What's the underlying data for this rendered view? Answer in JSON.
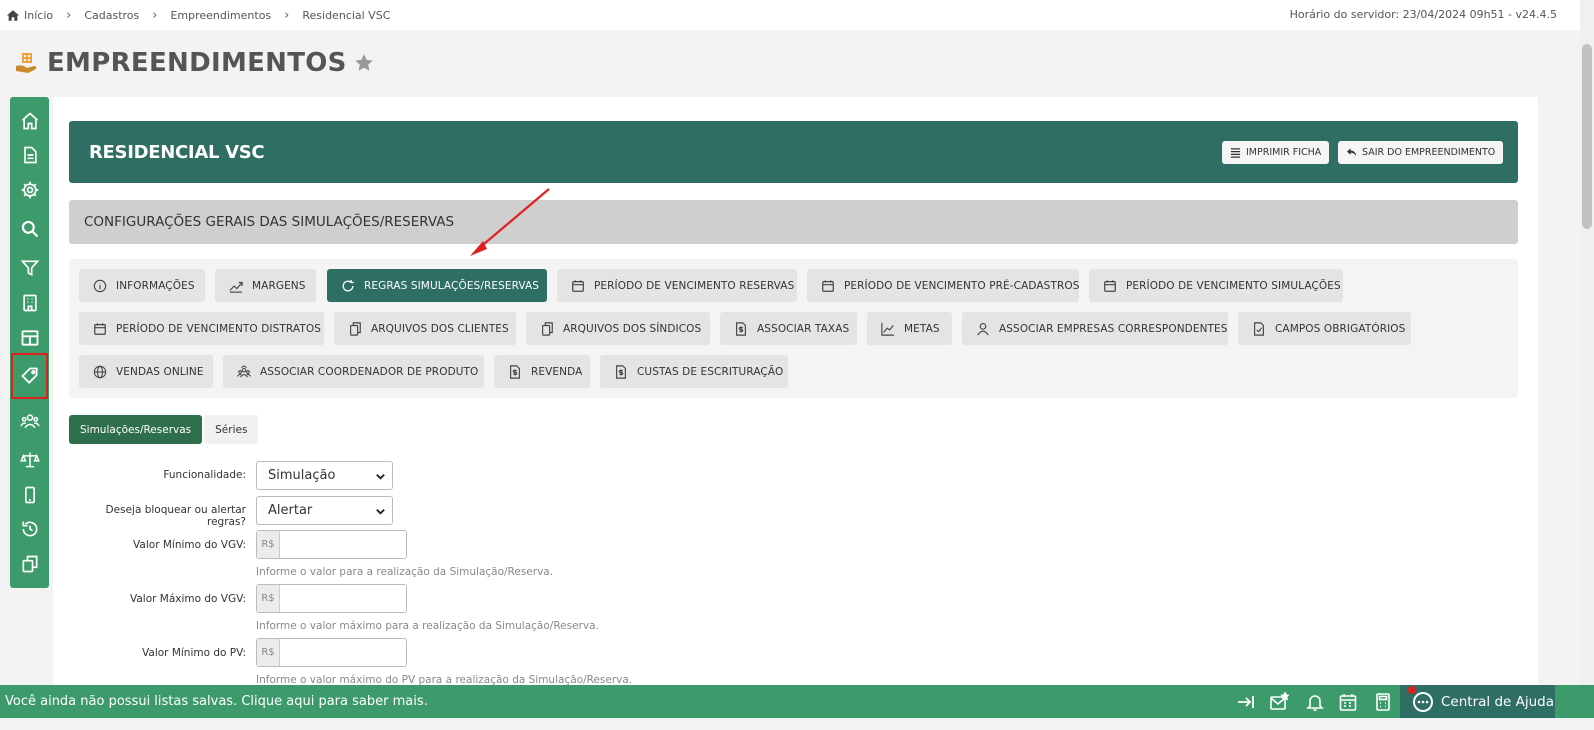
{
  "breadcrumb": [
    "Início",
    "Cadastros",
    "Empreendimentos",
    "Residencial VSC"
  ],
  "server_time": "Horário do servidor: 23/04/2024 09h51 - v24.4.5",
  "page_title": "EMPREENDIMENTOS",
  "sidebar_icons": [
    "home-icon",
    "document-icon",
    "gear-icon",
    "search-icon",
    "filter-icon",
    "building-icon",
    "table-icon",
    "tag-icon",
    "users-icon",
    "scale-icon",
    "mobile-icon",
    "history-icon",
    "copy-icon"
  ],
  "enterprise": {
    "name": "RESIDENCIAL VSC",
    "print_label": "IMPRIMIR FICHA",
    "exit_label": "SAIR DO EMPREENDIMENTO"
  },
  "section_title": "CONFIGURAÇÕES GERAIS DAS SIMULAÇÕES/RESERVAS",
  "tabs": [
    {
      "label": "INFORMAÇÕES",
      "icon": "info-icon"
    },
    {
      "label": "MARGENS",
      "icon": "chart-up-icon"
    },
    {
      "label": "REGRAS SIMULAÇÕES/RESERVAS",
      "icon": "refresh-icon",
      "active": true
    },
    {
      "label": "PERÍODO DE VENCIMENTO RESERVAS",
      "icon": "calendar-icon"
    },
    {
      "label": "PERÍODO DE VENCIMENTO PRÉ-CADASTROS",
      "icon": "calendar-icon"
    },
    {
      "label": "PERÍODO DE VENCIMENTO SIMULAÇÕES",
      "icon": "calendar-icon"
    },
    {
      "label": "PERÍODO DE VENCIMENTO DISTRATOS",
      "icon": "calendar-icon"
    },
    {
      "label": "ARQUIVOS DOS CLIENTES",
      "icon": "files-icon"
    },
    {
      "label": "ARQUIVOS DOS SÍNDICOS",
      "icon": "files-icon"
    },
    {
      "label": "ASSOCIAR TAXAS",
      "icon": "money-doc-icon"
    },
    {
      "label": "METAS",
      "icon": "line-chart-icon"
    },
    {
      "label": "ASSOCIAR EMPRESAS CORRESPONDENTES",
      "icon": "user-icon"
    },
    {
      "label": "CAMPOS OBRIGATÓRIOS",
      "icon": "checked-doc-icon"
    },
    {
      "label": "VENDAS ONLINE",
      "icon": "globe-icon"
    },
    {
      "label": "ASSOCIAR COORDENADOR DE PRODUTO",
      "icon": "team-icon"
    },
    {
      "label": "REVENDA",
      "icon": "money-doc-icon"
    },
    {
      "label": "CUSTAS DE ESCRITURAÇÃO",
      "icon": "money-doc-icon"
    }
  ],
  "sub_tabs": [
    "Simulações/Reservas",
    "Séries"
  ],
  "form": {
    "funcionalidade_label": "Funcionalidade:",
    "funcionalidade_value": "Simulação",
    "bloquear_label": "Deseja bloquear ou alertar regras?",
    "bloquear_value": "Alertar",
    "currency_prefix": "R$",
    "vgv_min_label": "Valor Mínimo do VGV:",
    "vgv_min_help": "Informe o valor para a realização da Simulação/Reserva.",
    "vgv_max_label": "Valor Máximo do VGV:",
    "vgv_max_help": "Informe o valor máximo para a realização da Simulação/Reserva.",
    "pv_min_label": "Valor Mínimo do PV:",
    "pv_min_help": "Informe o valor máximo do PV para a realização da Simulação/Reserva."
  },
  "footer": {
    "message": "Você ainda não possui listas salvas. Clique aqui para saber mais.",
    "help_label": "Central de Ajuda",
    "icons": [
      "collapse-icon",
      "mail-star-icon",
      "bell-icon",
      "calendar-icon",
      "calculator-icon",
      "chat-icon"
    ]
  },
  "colors": {
    "rail_green": "#3c9a6b",
    "banner_teal": "#2e6e63",
    "annotation_red": "#e02020"
  }
}
